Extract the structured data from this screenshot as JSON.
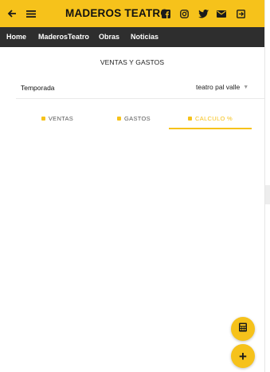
{
  "app": {
    "title": "MADEROS TEATRO",
    "accent_color": "#f6c21b",
    "nav_bg_color": "#2e2e2e"
  },
  "topbar": {
    "back_icon": "arrow-left-icon",
    "menu_icon": "hamburger-menu-icon",
    "social_icons": [
      "facebook-icon",
      "instagram-icon",
      "twitter-icon",
      "mail-icon",
      "logout-icon"
    ]
  },
  "nav": {
    "items": [
      "Home",
      "MaderosTeatro",
      "Obras",
      "Noticias"
    ]
  },
  "main": {
    "section_title": "VENTAS Y GASTOS",
    "season_label": "Temporada",
    "season_value": "teatro pal valle",
    "tabs": [
      {
        "label": "VENTAS",
        "active": false
      },
      {
        "label": "GASTOS",
        "active": false
      },
      {
        "label": "CALCULO %",
        "active": true
      }
    ]
  },
  "fabs": {
    "calc_icon": "calculator-icon",
    "add_icon": "plus-icon",
    "add_label": "+"
  }
}
